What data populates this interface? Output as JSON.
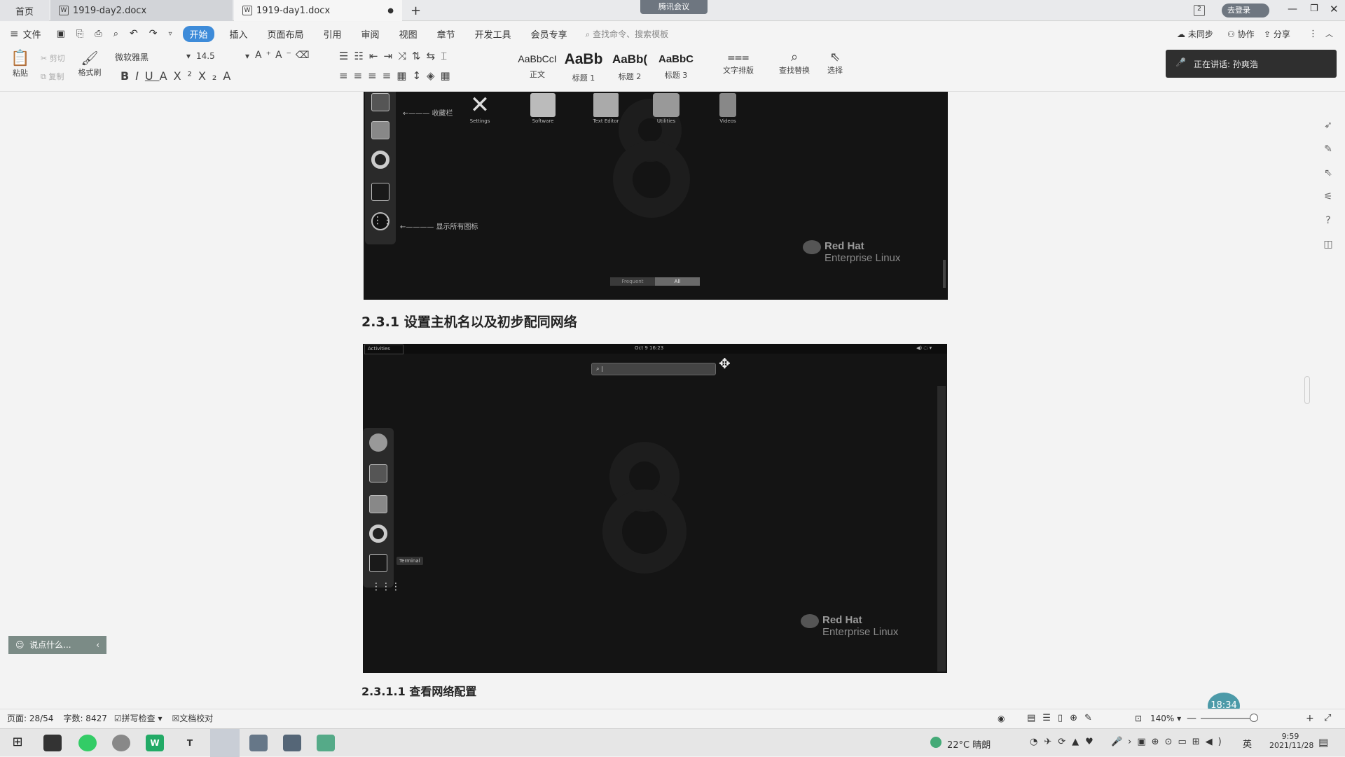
{
  "tabs": {
    "home": "首页",
    "doc1": "1919-day2.docx",
    "doc2": "1919-day1.docx",
    "new": "+",
    "meeting_badge": "腾讯会议",
    "login": "去登录"
  },
  "menubar": {
    "file": "文件",
    "items": [
      "开始",
      "插入",
      "页面布局",
      "引用",
      "审阅",
      "视图",
      "章节",
      "开发工具",
      "会员专享"
    ],
    "search": "查找命令、搜索模板",
    "sync": "未同步",
    "collab": "协作",
    "share": "分享"
  },
  "ribbon": {
    "paste": "粘贴",
    "cut": "剪切",
    "copy": "复制",
    "format_painter": "格式刷",
    "font_name": "微软雅黑",
    "font_size": "14.5",
    "styles": [
      {
        "preview": "AaBbCcI",
        "name": "正文"
      },
      {
        "preview": "AaBb",
        "name": "标题 1"
      },
      {
        "preview": "AaBb(",
        "name": "标题 2"
      },
      {
        "preview": "AaBbC",
        "name": "标题 3"
      }
    ],
    "text_layout": "文字排版",
    "find_replace": "查找替换",
    "select": "选择",
    "speaker_banner": "正在讲话: 孙爽浩"
  },
  "shot1": {
    "apps": [
      "Settings",
      "Software",
      "Text Editor",
      "Utilities",
      "Videos"
    ],
    "label_fav": "收藏栏",
    "label_show_apps": "显示所有图标",
    "frequent": "Frequent",
    "all": "All",
    "brand_line1": "Red Hat",
    "brand_line2": "Enterprise Linux"
  },
  "heading1": "2.3.1 设置主机名以及初步配同网络",
  "shot2": {
    "activities": "Activities",
    "clock": "Oct 9  16:23",
    "tooltip": "Terminal",
    "brand_line1": "Red Hat",
    "brand_line2": "Enterprise Linux"
  },
  "heading2": "2.3.1.1 查看网络配置",
  "chat_bubble": "说点什么...",
  "timer": "18:34",
  "status": {
    "page": "页面: 28/54",
    "words": "字数: 8427",
    "spell": "拼写检查",
    "proof": "文档校对",
    "zoom": "140%"
  },
  "taskbar": {
    "weather": "22°C  晴朗",
    "ime": "英",
    "time": "9:59",
    "date": "2021/11/28"
  }
}
